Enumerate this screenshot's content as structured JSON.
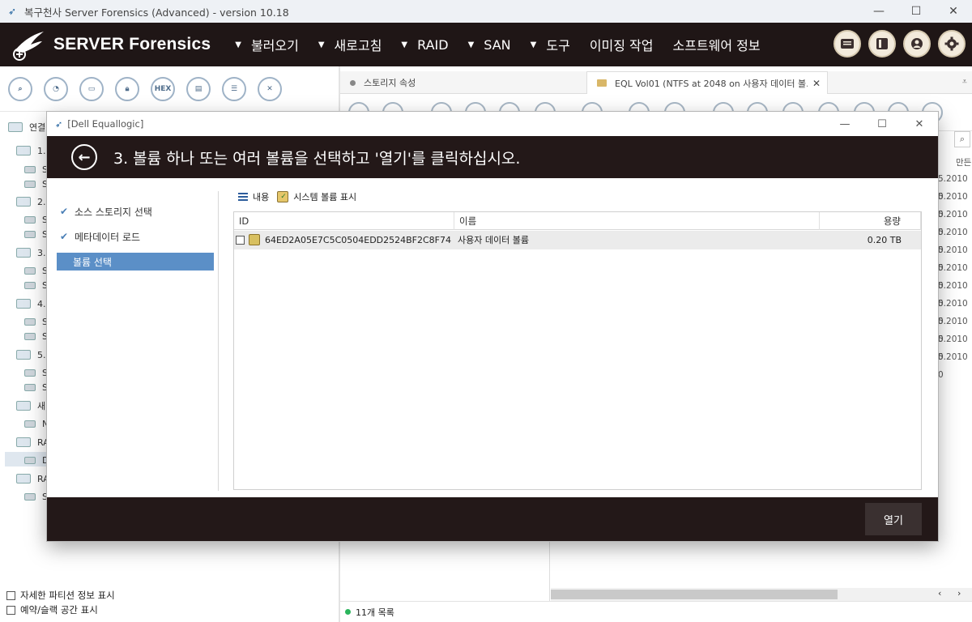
{
  "window": {
    "title": "복구천사 Server Forensics (Advanced) - version 10.18",
    "controls": {
      "minimize": "—",
      "maximize": "☐",
      "close": "✕"
    }
  },
  "app": {
    "brand": "SERVER Forensics",
    "menu": [
      {
        "label": "불러오기",
        "has_dropdown": true
      },
      {
        "label": "새로고침",
        "has_dropdown": true
      },
      {
        "label": "RAID",
        "has_dropdown": true
      },
      {
        "label": "SAN",
        "has_dropdown": true
      },
      {
        "label": "도구",
        "has_dropdown": true
      },
      {
        "label": "이미징 작업",
        "has_dropdown": false
      },
      {
        "label": "소프트웨어 정보",
        "has_dropdown": false
      }
    ],
    "header_icons": [
      "log-icon",
      "panel-icon",
      "user-icon",
      "settings-icon"
    ],
    "colors": {
      "header_bg": "#1f1616",
      "accent": "#5b8fc7",
      "status_green": "#2bb55c"
    }
  },
  "left_panel": {
    "toolbar_icons": [
      "search-icon",
      "chart-icon",
      "drive-icon",
      "lock-icon",
      "hex-icon",
      "disk-icon",
      "list-icon",
      "close-icon"
    ],
    "hex_label": "HEX",
    "tree_header": "연결",
    "tree": [
      {
        "label": "1.s",
        "level": 0
      },
      {
        "label": "S",
        "level": 1
      },
      {
        "label": "S",
        "level": 1
      },
      {
        "label": "2.s",
        "level": 0
      },
      {
        "label": "S",
        "level": 1
      },
      {
        "label": "S",
        "level": 1
      },
      {
        "label": "3.s",
        "level": 0
      },
      {
        "label": "S",
        "level": 1
      },
      {
        "label": "S",
        "level": 1
      },
      {
        "label": "4.s",
        "level": 0
      },
      {
        "label": "S",
        "level": 1
      },
      {
        "label": "S",
        "level": 1
      },
      {
        "label": "5.s",
        "level": 0
      },
      {
        "label": "S",
        "level": 1
      },
      {
        "label": "S",
        "level": 1
      },
      {
        "label": "새",
        "level": 0
      },
      {
        "label": "N",
        "level": 1
      },
      {
        "label": "RA",
        "level": 0
      },
      {
        "label": "D",
        "level": 1
      },
      {
        "label": "RA",
        "level": 0
      },
      {
        "label": "S",
        "level": 1
      }
    ],
    "options": [
      {
        "label": "자세한 파티션 정보 표시",
        "checked": false
      },
      {
        "label": "예약/슬랙 공간 표시",
        "checked": false
      }
    ]
  },
  "right_panel": {
    "tabs": [
      {
        "label": "스토리지 속성",
        "active": false
      },
      {
        "label": "EQL Vol01 (NTFS at 2048 on 사용자 데이터 볼...",
        "active": true,
        "close": "✕"
      }
    ],
    "column_header": "만든",
    "dates": [
      "5.2010 0",
      "5.2010 0",
      "5.2010 0",
      "5.2010 0",
      "5.2010 0",
      "5.2010 0",
      "5.2010 0",
      "5.2010 0",
      "5.2010 0",
      "5.2010 0",
      "5.2010 0",
      "5.2010 0",
      "5.2010 0"
    ],
    "status": "11개 목록"
  },
  "dialog": {
    "title": "[Dell Equallogic]",
    "step_heading": "3. 볼륨 하나 또는 여러 볼륨을 선택하고 '열기'를 클릭하십시오.",
    "steps": [
      {
        "label": "소스 스토리지 선택",
        "done": true,
        "active": false
      },
      {
        "label": "메타데이터 로드",
        "done": true,
        "active": false
      },
      {
        "label": "볼륨 선택",
        "done": false,
        "active": true
      }
    ],
    "toolbar": {
      "contents_label": "내용",
      "system_label": "시스템 볼륨 표시"
    },
    "table": {
      "columns": [
        "ID",
        "이름",
        "용량"
      ],
      "rows": [
        {
          "checked": false,
          "id": "64ED2A05E7C5C0504EDD2524BF2C8F74",
          "name": "사용자 데이터 볼륨",
          "size": "0.20 TB"
        }
      ]
    },
    "open_button": "열기"
  }
}
